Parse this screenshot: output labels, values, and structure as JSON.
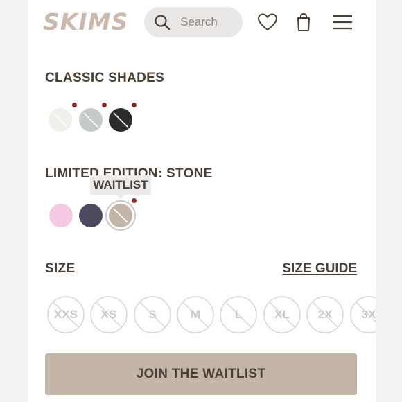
{
  "header": {
    "logo": "SKIMS",
    "search_placeholder": "Search",
    "icons": [
      "search-icon",
      "heart-icon",
      "shopping-bag-icon",
      "hamburger-menu-icon"
    ]
  },
  "classic": {
    "title": "CLASSIC SHADES",
    "swatches": [
      {
        "name": "classic-1",
        "color": "#f1efea",
        "unavailable": true,
        "indicator": true
      },
      {
        "name": "classic-2",
        "color": "#c4cac9",
        "unavailable": true,
        "indicator": true
      },
      {
        "name": "classic-3",
        "color": "#2b2b2d",
        "unavailable": true,
        "indicator": true
      }
    ]
  },
  "limited": {
    "title": "LIMITED EDITION: STONE",
    "tooltip": "WAITLIST",
    "swatches": [
      {
        "name": "limited-1",
        "color": "#f5c9e4",
        "unavailable": false
      },
      {
        "name": "limited-2",
        "color": "#4b4a5e",
        "unavailable": false
      },
      {
        "name": "stone",
        "color": "#c4b5a9",
        "unavailable": true,
        "selected": true,
        "indicator": true
      }
    ]
  },
  "size": {
    "title": "SIZE",
    "guide_label": "SIZE GUIDE",
    "options": [
      "XXS",
      "XS",
      "S",
      "M",
      "L",
      "XL",
      "2X",
      "3X"
    ]
  },
  "cta_label": "JOIN THE WAITLIST",
  "colors": {
    "indicator_dot": "#8d2a20",
    "button": "#c4b5a9",
    "text": "#4a4038",
    "logo": "#cbb9ad"
  }
}
